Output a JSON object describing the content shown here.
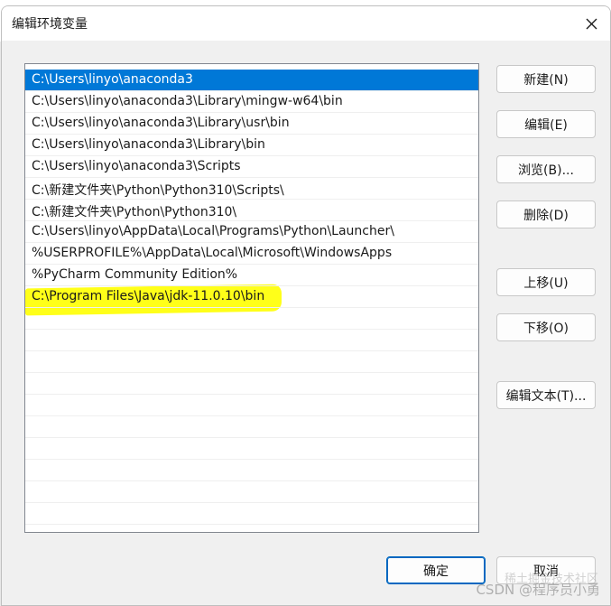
{
  "window": {
    "title": "编辑环境变量",
    "close_icon": "close-icon"
  },
  "path_list": {
    "selected_index": 0,
    "highlighted_index": 9,
    "highlight_color": "#ffff00",
    "selection_color": "#0078d7",
    "items": [
      {
        "text": "C:\\Users\\linyo\\anaconda3"
      },
      {
        "text": "C:\\Users\\linyo\\anaconda3\\Library\\mingw-w64\\bin"
      },
      {
        "text": "C:\\Users\\linyo\\anaconda3\\Library\\usr\\bin"
      },
      {
        "text": "C:\\Users\\linyo\\anaconda3\\Library\\bin"
      },
      {
        "text": "C:\\Users\\linyo\\anaconda3\\Scripts"
      },
      {
        "text": "C:\\新建文件夹\\Python\\Python310\\Scripts\\"
      },
      {
        "text": "C:\\新建文件夹\\Python\\Python310\\"
      },
      {
        "text": "C:\\Users\\linyo\\AppData\\Local\\Programs\\Python\\Launcher\\"
      },
      {
        "text": "%USERPROFILE%\\AppData\\Local\\Microsoft\\WindowsApps"
      },
      {
        "text": "%PyCharm Community Edition%"
      },
      {
        "text": "C:\\Program Files\\Java\\jdk-11.0.10\\bin"
      }
    ]
  },
  "buttons": {
    "new": "新建(N)",
    "edit": "编辑(E)",
    "browse": "浏览(B)...",
    "delete": "删除(D)",
    "move_up": "上移(U)",
    "move_down": "下移(O)",
    "edit_text": "编辑文本(T)...",
    "ok": "确定",
    "cancel": "取消"
  },
  "watermark": {
    "line1": "稀土掘金技术社区",
    "line2": "CSDN @程序员小勇"
  }
}
